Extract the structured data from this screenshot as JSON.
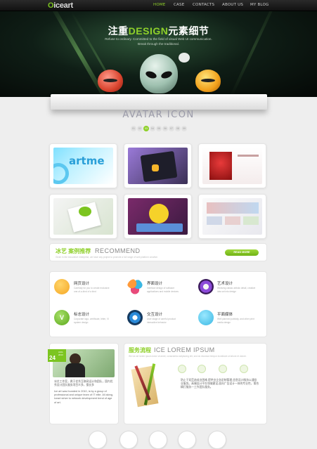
{
  "header": {
    "logo_o": "O",
    "logo_rest": "iceart",
    "nav": [
      {
        "label": "HOME",
        "active": true
      },
      {
        "label": "CASE"
      },
      {
        "label": "CONTACTS"
      },
      {
        "label": "ABOUT US"
      },
      {
        "label": "MY BLOG"
      }
    ]
  },
  "hero": {
    "title_a": "注重",
    "title_b": "DESIGN",
    "title_c": "元素细节",
    "sub1": "Refuse to ordinary. Committed to the field of visual Web UI communication.",
    "sub2": "Break through the traditional."
  },
  "gallery": {
    "title": "AVATAR ICON",
    "pages": [
      "01",
      "02",
      "03",
      "04",
      "05",
      "06",
      "07",
      "08",
      "09"
    ],
    "current": "03",
    "first_thumb_text": "artme"
  },
  "recommend": {
    "title": "冰艺 案例推荐",
    "title_en": "RECOMMEND",
    "desc": "Given in the innovative enterprise, we have any project to promote a full range of web platform creative.",
    "button": "READ MORE"
  },
  "services": [
    {
      "title": "网页设计",
      "desc": "Carefully for you to create exclusive one-of-a-kind of a kind",
      "color": "#f5a623",
      "icon": "paint-icon"
    },
    {
      "title": "界面设计",
      "desc": "Interface design of software applications and mobile devices",
      "color": "#e84a7a",
      "icon": "color-circles-icon"
    },
    {
      "title": "艺术设计",
      "desc": "Weaving classic artistic detail, creative idea art into design",
      "color": "#8c4ad9",
      "icon": "lens-icon"
    },
    {
      "title": "标志设计",
      "desc": "Corporate logo, certificate, letter, VI system design",
      "color": "#6cc22a",
      "icon": "v-logo-icon"
    },
    {
      "title": "交互设计",
      "desc": "User stage of careful product interactive behavior",
      "color": "#2a8ad9",
      "icon": "interaction-icon"
    },
    {
      "title": "平面媒体",
      "desc": "Well planned publicity, and other print media design",
      "color": "#3ab7e3",
      "icon": "media-icon"
    }
  ],
  "about": {
    "date_day": "24",
    "date_month": "AUG",
    "date_year": "2013",
    "cn": "冰艺工作室，属于优秀互联网设计和团队，国内优秀设计团队服务项目众多，擅长多",
    "en": "Ice art was founded in 2010, is by a group of professional and unique team of IT elite. All along, Iceart strive to network development trend of age of art."
  },
  "flow": {
    "title": "服务流程",
    "title_en": "ICE LOREM IPSUM",
    "sub": "We ice art lorem ipsum dolor sit amet, consectetur adipiscing elit, sed do eiusmod tempor incididunt ut labore et dolore.",
    "desc": "防止于双范造成业困难,提供业企务定制管理,信息设计服务以通信业服务。高端设计平台领域建设,面向广告设计一体的专业性，需合精打服务一工作团队服务。",
    "icons": [
      "chat-icon",
      "mail-icon",
      "monitor-icon",
      "heart-icon"
    ]
  },
  "bottom_icons": [
    "apple-icon",
    "safari-icon",
    "calendar-icon",
    "globe-icon",
    "camera-icon"
  ],
  "colors": {
    "accent": "#8fd02a"
  }
}
